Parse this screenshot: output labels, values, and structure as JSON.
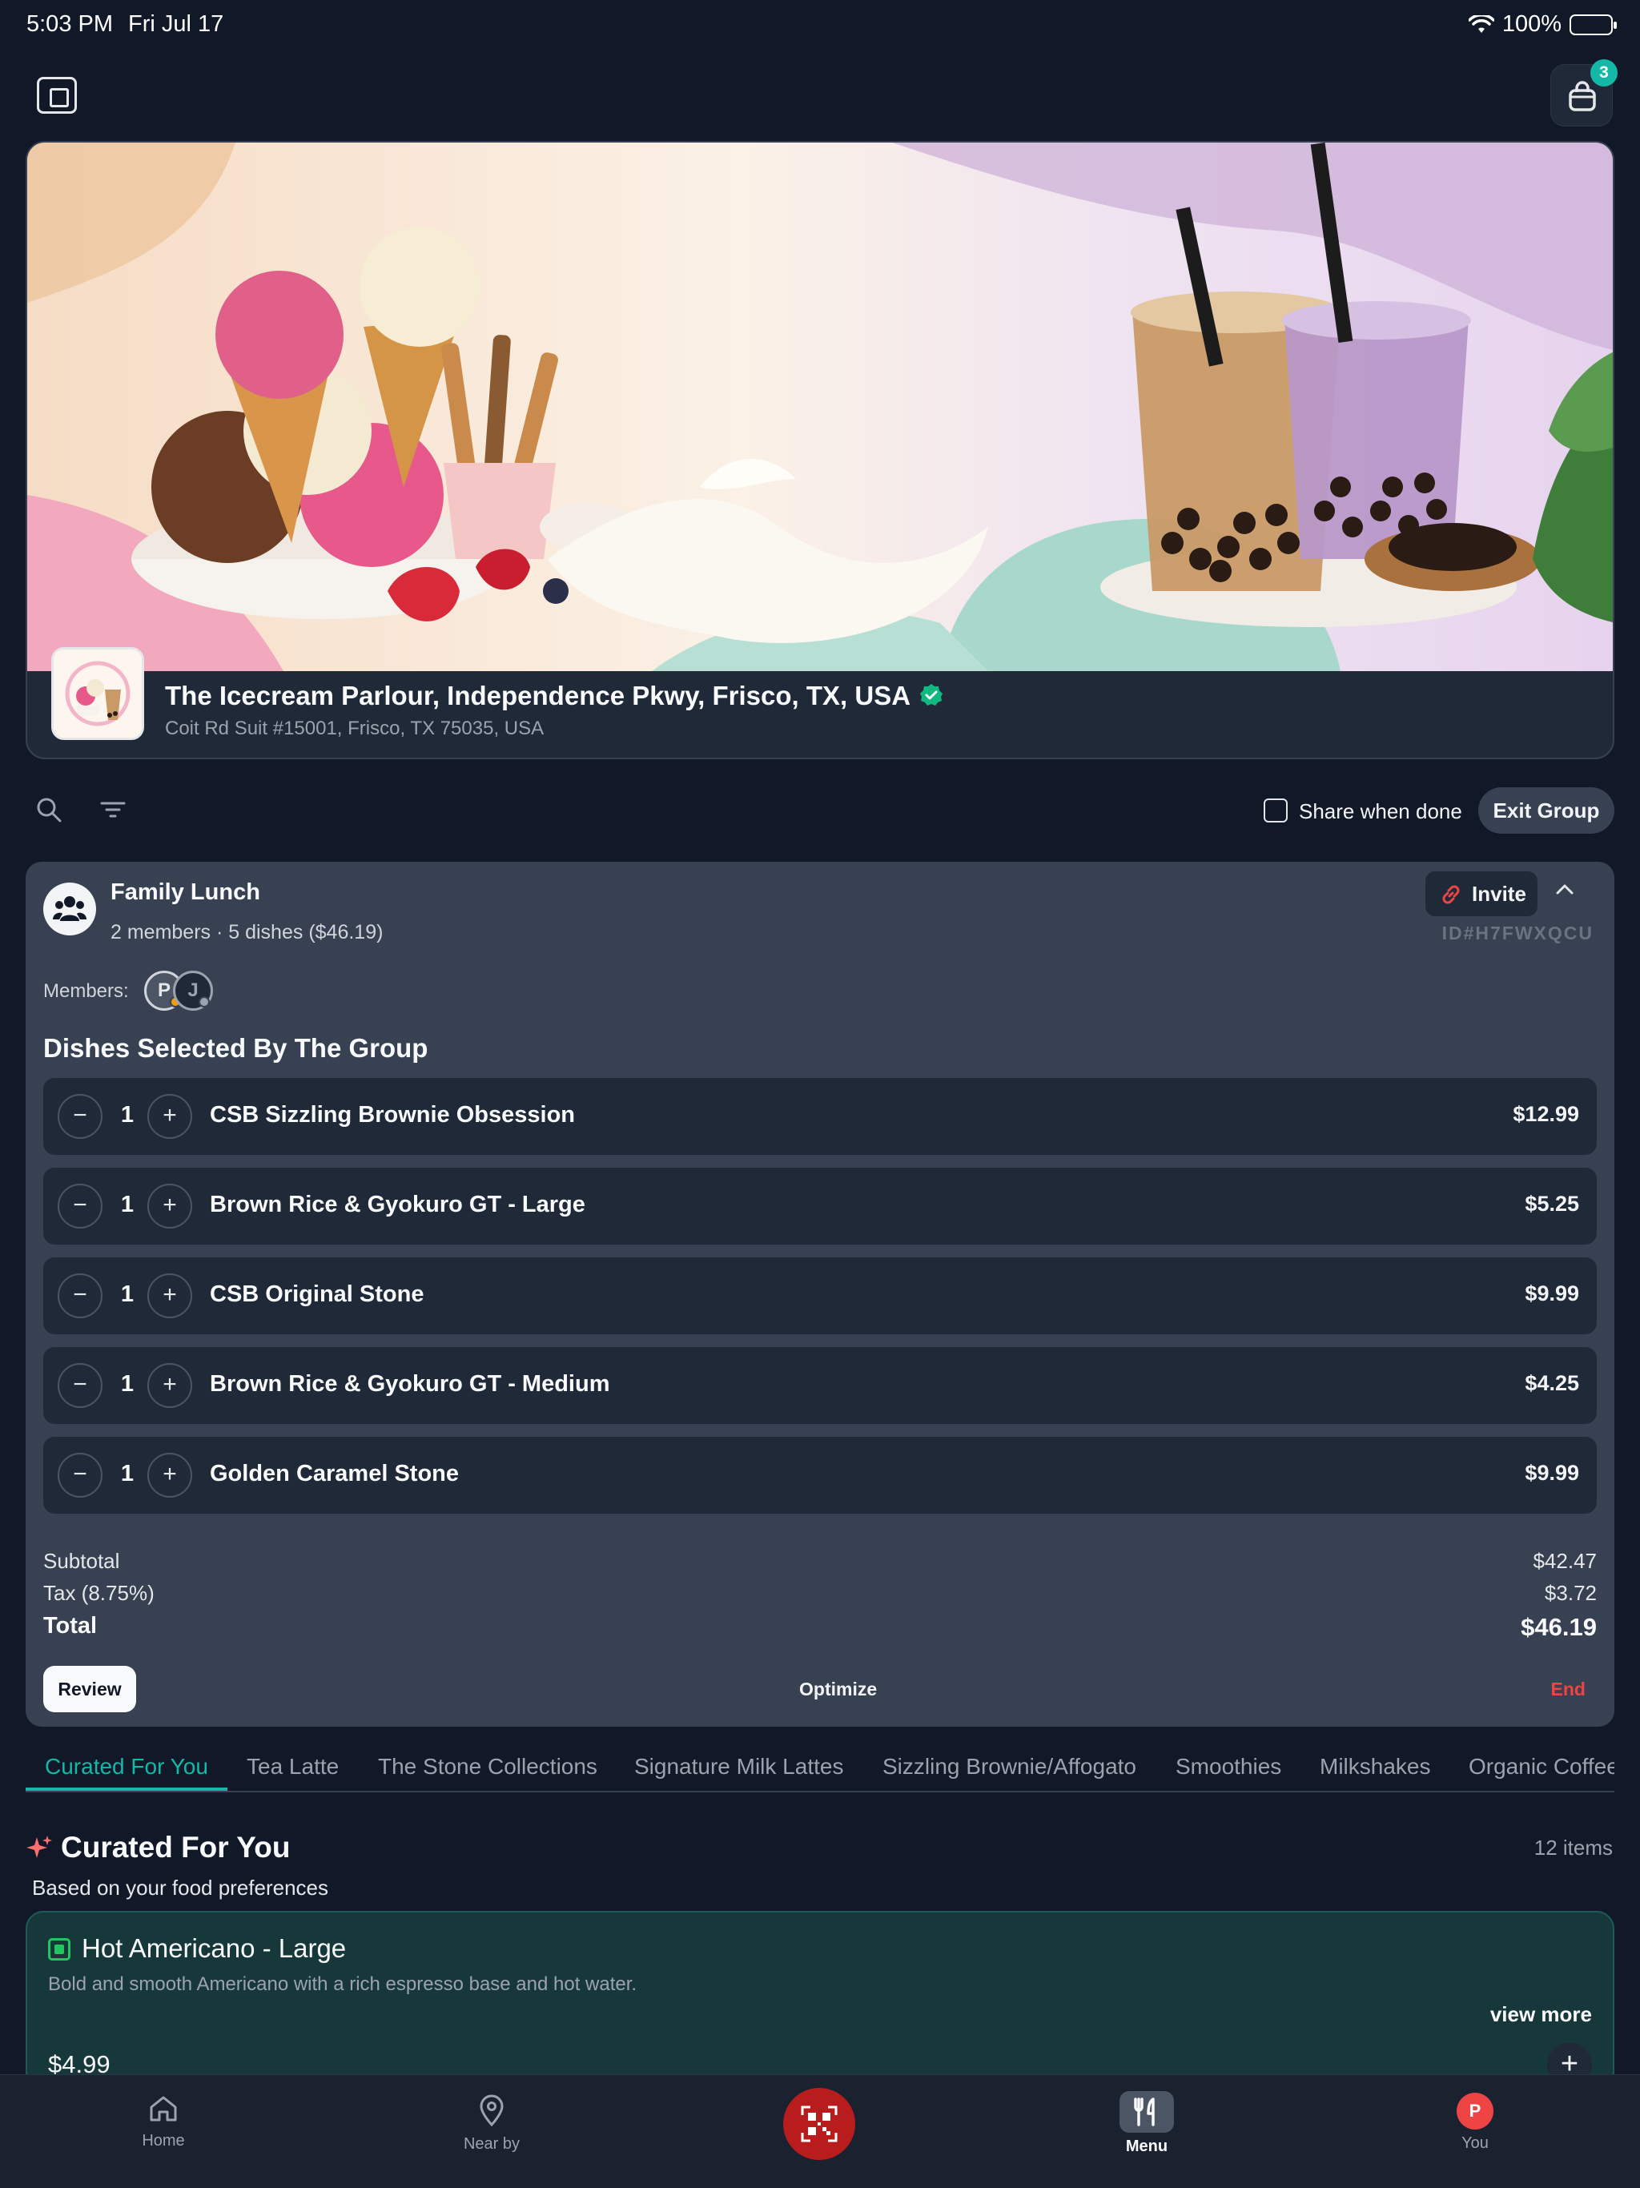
{
  "status_bar": {
    "time": "5:03 PM",
    "date": "Fri Jul 17",
    "battery": "100%"
  },
  "header": {
    "cart_count": "3",
    "icons": {
      "sidebar": "sidebar-icon",
      "cart": "shopping-bag-icon"
    }
  },
  "restaurant": {
    "name": "The Icecream Parlour, Independence Pkwy, Frisco, TX, USA",
    "address": "Coit Rd Suit #15001, Frisco, TX 75035, USA",
    "verified": true
  },
  "toolbar": {
    "share_label": "Share when done",
    "exit_label": "Exit Group"
  },
  "group": {
    "name": "Family Lunch",
    "summary": "2 members · 5 dishes ($46.19)",
    "invite_label": "Invite",
    "id": "ID#H7FWXQCU",
    "members_label": "Members:",
    "members": [
      {
        "initial": "P",
        "status_color": "#f59e0b"
      },
      {
        "initial": "J",
        "status_color": "#9ca3af"
      }
    ],
    "dishes_heading": "Dishes Selected By The Group",
    "dishes": [
      {
        "qty": "1",
        "name": "CSB Sizzling Brownie Obsession",
        "price": "$12.99"
      },
      {
        "qty": "1",
        "name": "Brown Rice & Gyokuro GT - Large",
        "price": "$5.25"
      },
      {
        "qty": "1",
        "name": "CSB Original Stone",
        "price": "$9.99"
      },
      {
        "qty": "1",
        "name": "Brown Rice & Gyokuro GT - Medium",
        "price": "$4.25"
      },
      {
        "qty": "1",
        "name": "Golden Caramel Stone",
        "price": "$9.99"
      }
    ],
    "subtotal_label": "Subtotal",
    "subtotal": "$42.47",
    "tax_label": "Tax (8.75%)",
    "tax": "$3.72",
    "total_label": "Total",
    "total": "$46.19",
    "review_label": "Review",
    "optimize_label": "Optimize",
    "end_label": "End"
  },
  "tabs": [
    "Curated For You",
    "Tea Latte",
    "The Stone Collections",
    "Signature Milk Lattes",
    "Sizzling Brownie/Affogato",
    "Smoothies",
    "Milkshakes",
    "Organic Coffee"
  ],
  "curated": {
    "title": "Curated For You",
    "count": "12 items",
    "subtitle": "Based on your food preferences",
    "item": {
      "name": "Hot Americano - Large",
      "description": "Bold and smooth Americano with a rich espresso base and hot water.",
      "view_more": "view more",
      "price": "$4.99"
    }
  },
  "bottom_nav": {
    "home": "Home",
    "nearby": "Near by",
    "menu": "Menu",
    "you_initial": "P",
    "you": "You"
  },
  "colors": {
    "accent": "#14b8a6",
    "danger": "#ef4444",
    "background": "#111827",
    "panel": "#374151",
    "card": "#1f2937"
  }
}
